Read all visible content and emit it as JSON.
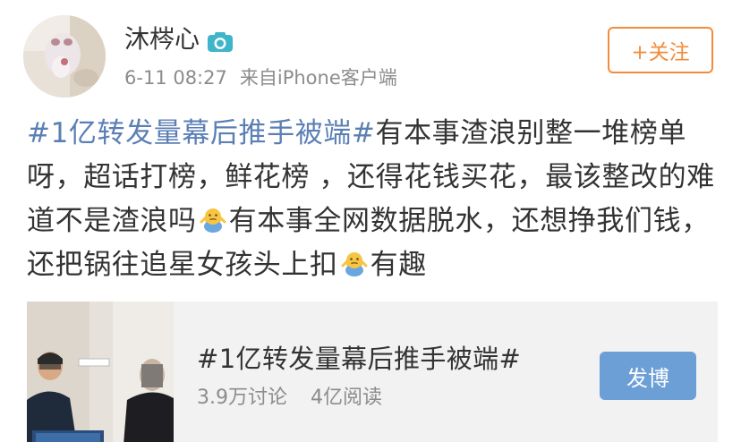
{
  "post": {
    "author": "沐梣心",
    "timestamp": "6-11 08:27",
    "source": "来自iPhone客户端",
    "follow_label": "+关注",
    "verified_icon": "camera-badge-icon",
    "text": {
      "hashtag": "#1亿转发量幕后推手被端#",
      "part1": "有本事渣浪别整一堆榜单呀，超话打榜，鲜花榜 ，还得花钱买花，最该整改的难道不是渣浪吗",
      "emoji_name": "shrug-face-icon",
      "part2": "有本事全网数据脱水，还想挣我们钱，还把锅往追星女孩头上扣",
      "part3": "有趣"
    }
  },
  "topic_card": {
    "title": "#1亿转发量幕后推手被端#",
    "discussions": "3.9万讨论",
    "reads": "4亿阅读",
    "post_button": "发博"
  },
  "colors": {
    "hashtag": "#5b7fb5",
    "follow": "#f28c3c",
    "post_button": "#6b9fd6",
    "card_bg": "#f2f2f2"
  }
}
